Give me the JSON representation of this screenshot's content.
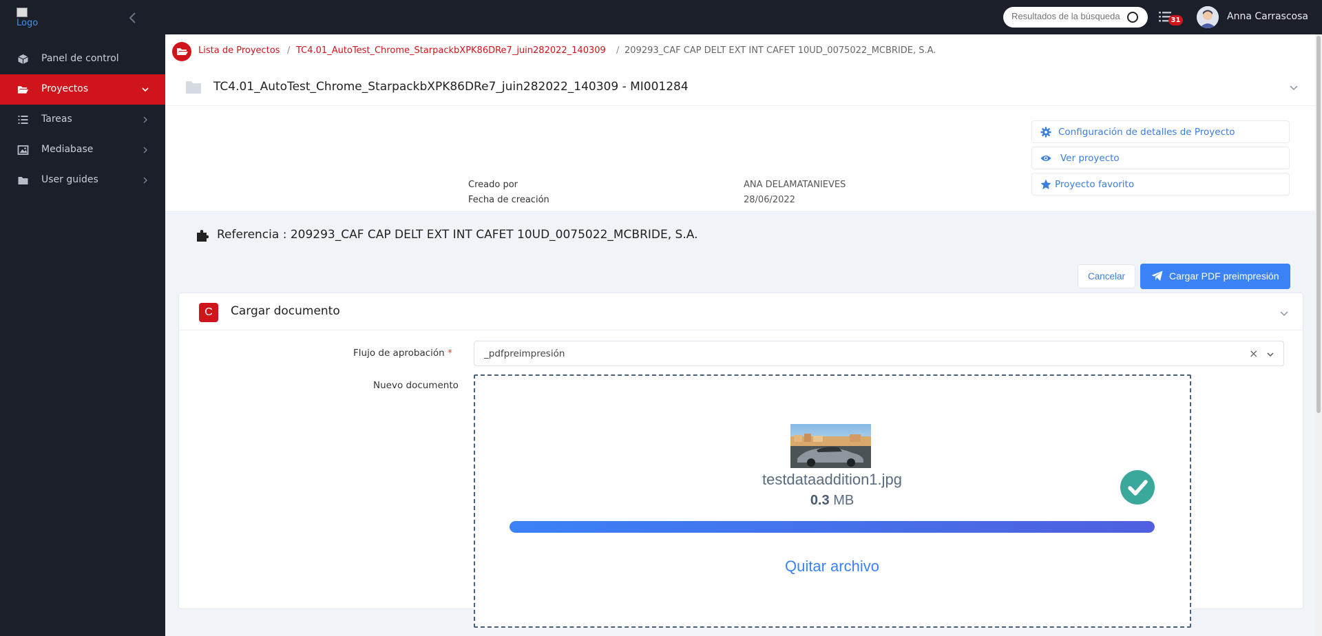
{
  "app": {
    "logo_alt": "Logo"
  },
  "sidebar": {
    "items": [
      {
        "label": "Panel de control",
        "icon": "cube-icon"
      },
      {
        "label": "Proyectos",
        "icon": "folder-open-icon",
        "active": true
      },
      {
        "label": "Tareas",
        "icon": "list-icon"
      },
      {
        "label": "Mediabase",
        "icon": "image-icon"
      },
      {
        "label": "User guides",
        "icon": "folder-icon"
      }
    ]
  },
  "topbar": {
    "search_placeholder": "Resultados de la búsqueda",
    "task_count": "31",
    "user_name": "Anna Carrascosa"
  },
  "breadcrumb": {
    "items": [
      "Lista de Proyectos",
      "TC4.01_AutoTest_Chrome_StarpackbXPK86DRe7_juin282022_140309",
      "209293_CAF CAP DELT EXT INT CAFET 10UD_0075022_MCBRIDE, S.A."
    ],
    "separator": "/"
  },
  "project": {
    "title": "TC4.01_AutoTest_Chrome_StarpackbXPK86DRe7_juin282022_140309 - MI001284",
    "created_by_label": "Creado por",
    "created_by": "ANA DELAMATANIEVES",
    "created_date_label": "Fecha de creación",
    "created_date": "28/06/2022"
  },
  "actions": {
    "config": "Configuración de detalles de Proyecto",
    "view": "Ver proyecto",
    "favorite": "Proyecto favorito"
  },
  "reference": {
    "text": "Referencia : 209293_CAF CAP DELT EXT INT CAFET 10UD_0075022_MCBRIDE, S.A."
  },
  "buttons": {
    "cancel": "Cancelar",
    "upload": "Cargar PDF preimpresión"
  },
  "upload_card": {
    "badge": "C",
    "title": "Cargar documento",
    "flow_label": "Flujo de aprobación",
    "required_mark": "*",
    "flow_value": "_pdfpreimpresión",
    "clear_symbol": "×",
    "doc_label": "Nuevo documento",
    "file_name": "testdataaddition1.jpg",
    "file_size_value": "0.3",
    "file_size_unit": "MB",
    "progress_fraction": 1.0,
    "remove_label": "Quitar archivo"
  },
  "colors": {
    "brand_red": "#d0141b",
    "accent_blue": "#3b82f6",
    "success": "#3aa89a",
    "sidebar_bg": "#1b1f2a"
  }
}
